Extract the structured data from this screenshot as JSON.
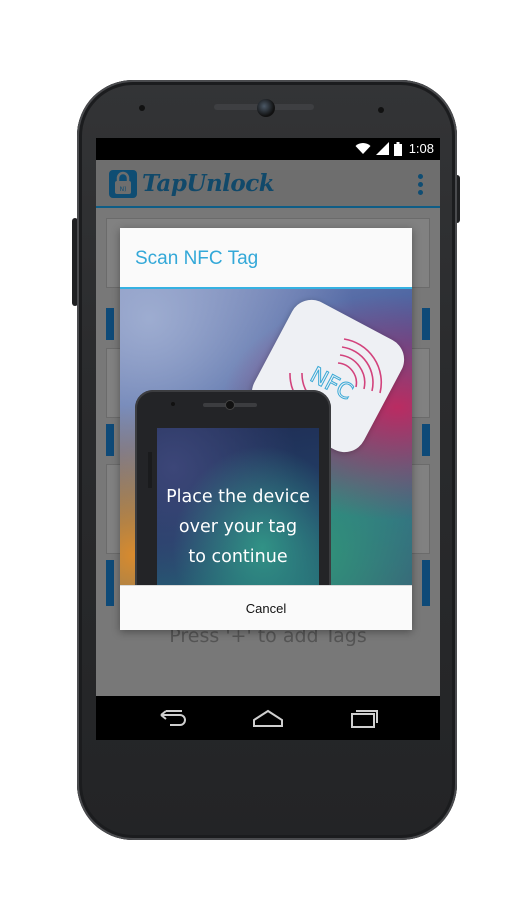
{
  "status_bar": {
    "time": "1:08"
  },
  "app_bar": {
    "title": "TapUnlock"
  },
  "content": {
    "empty_hint": "Press '+' to add Tags"
  },
  "dialog": {
    "title": "Scan NFC Tag",
    "nfc_card_text": "NFC",
    "instruction_lines": [
      "Place the device",
      "over your tag",
      "to continue"
    ],
    "cancel_label": "Cancel"
  },
  "colors": {
    "accent": "#33a8d8",
    "app_title": "#11496a",
    "dim_background": "#787878",
    "nfc_wave": "#d03070"
  },
  "icons": {
    "app_logo": "lock-nfc-icon",
    "overflow": "overflow-menu-icon",
    "wifi": "wifi-icon",
    "signal": "signal-icon",
    "battery": "battery-icon",
    "back": "back-icon",
    "home": "home-icon",
    "recents": "recents-icon"
  }
}
